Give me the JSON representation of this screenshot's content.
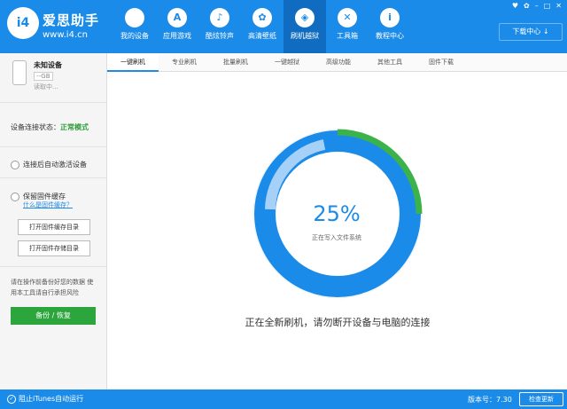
{
  "header": {
    "brand_name": "爱思助手",
    "brand_url": "www.i4.cn",
    "logo_text": "i4",
    "nav": [
      {
        "label": "我的设备",
        "icon": "apple-icon"
      },
      {
        "label": "应用游戏",
        "icon": "app-store-icon"
      },
      {
        "label": "酷炫铃声",
        "icon": "bell-icon"
      },
      {
        "label": "高清壁纸",
        "icon": "flower-icon"
      },
      {
        "label": "刷机越狱",
        "icon": "dropbox-icon"
      },
      {
        "label": "工具箱",
        "icon": "tools-icon"
      },
      {
        "label": "教程中心",
        "icon": "info-icon"
      }
    ],
    "download_label": "下载中心"
  },
  "sidebar": {
    "device_name": "未知设备",
    "capacity": "--GB",
    "reading": "读取中...",
    "conn_label": "设备连接状态：",
    "conn_value": "正常模式",
    "opt_autoactivate": "连接后自动激活设备",
    "opt_keepcache": "保留固件缓存",
    "cache_link": "什么是固件缓存？",
    "btn_open_cache": "打开固件缓存目录",
    "btn_open_store": "打开固件存储目录",
    "note": "请在操作前备份好您的数据 使用本工具请自行承担风险",
    "backup_button": "备份 / 恢复"
  },
  "tabs": [
    "一键刷机",
    "专业刷机",
    "批量刷机",
    "一键越狱",
    "高级功能",
    "其他工具",
    "固件下载"
  ],
  "main": {
    "progress_percent": 25,
    "progress_label": "25%",
    "progress_sub": "正在写入文件系统",
    "message": "正在全新刷机，请勿断开设备与电脑的连接",
    "colors": {
      "blue": "#1a8be8",
      "light_blue": "#a5d0f8",
      "green": "#3cb34a"
    }
  },
  "statusbar": {
    "itunes": "阻止iTunes自动运行",
    "version": "版本号：7.30",
    "update": "检查更新"
  }
}
